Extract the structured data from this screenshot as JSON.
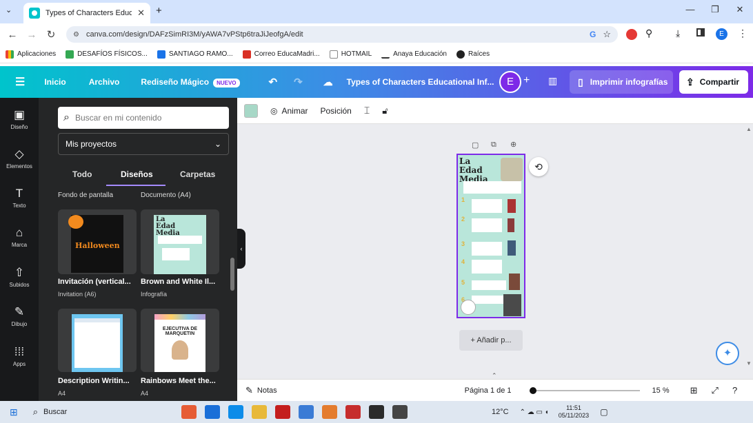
{
  "browser": {
    "tab_title": "Types of Characters Education",
    "url": "canva.com/design/DAFzSimRI3M/yAWA7vPStp6traJiJeofgA/edit",
    "bookmarks": [
      {
        "label": "Aplicaciones",
        "color": "#ea4335"
      },
      {
        "label": "DESAFÍOS FÍSICOS...",
        "color": "#34a853"
      },
      {
        "label": "SANTIAGO RAMO...",
        "color": "#1a73e8"
      },
      {
        "label": "Correo EducaMadri...",
        "color": "#d93025"
      },
      {
        "label": "HOTMAIL",
        "color": "#0078d4"
      },
      {
        "label": "Anaya Educación",
        "color": "#333333"
      },
      {
        "label": "Raíces",
        "color": "#222222"
      }
    ]
  },
  "header": {
    "menu_items": [
      "Inicio",
      "Archivo",
      "Rediseño Mágico"
    ],
    "badge": "NUEVO",
    "doc_title": "Types of Characters Educational Inf...",
    "avatar_letter": "E",
    "print_label": "Imprimir infografías",
    "share_label": "Compartir"
  },
  "rail": [
    "Diseño",
    "Elementos",
    "Texto",
    "Marca",
    "Subidos",
    "Dibujo",
    "Apps"
  ],
  "panel": {
    "search_placeholder": "Buscar en mi contenido",
    "projects_label": "Mis proyectos",
    "tabs": [
      "Todo",
      "Diseños",
      "Carpetas"
    ],
    "cut_labels": [
      "Fondo de pantalla",
      "Documento (A4)"
    ],
    "cards": [
      {
        "title": "Invitación (vertical...",
        "sub": "Invitation (A6)",
        "thumb_text": "Halloween"
      },
      {
        "title": "Brown and White Il...",
        "sub": "Infografía",
        "thumb_text": "La Edad Media"
      },
      {
        "title": "Description Writin...",
        "sub": "A4",
        "thumb_text": ""
      },
      {
        "title": "Rainbows Meet the...",
        "sub": "A4",
        "thumb_text": "EJECUTIVA DE MARQUETIN"
      }
    ]
  },
  "context": {
    "animate": "Animar",
    "position": "Posición"
  },
  "canvas": {
    "page_title": "La Edad Media",
    "add_page": "+ Añadir p...",
    "numbers": [
      "1",
      "2",
      "3",
      "4",
      "5",
      "6"
    ]
  },
  "footer": {
    "notes": "Notas",
    "page_label": "Página 1 de 1",
    "zoom": "15 %"
  },
  "taskbar": {
    "search": "Buscar",
    "temp": "12°C",
    "time": "11:51",
    "date": "05/11/2023"
  }
}
